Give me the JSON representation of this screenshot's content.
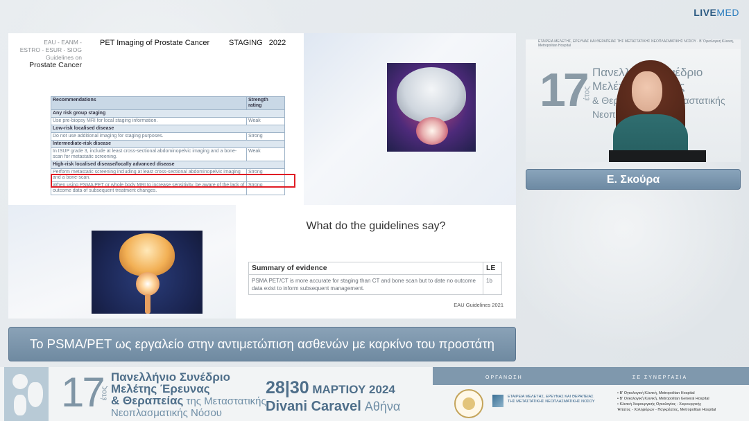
{
  "brand": {
    "live": "LIVE",
    "med": "MED"
  },
  "slide": {
    "eau_lines": [
      "EAU - EANM -",
      "ESTRO - ESUR - SIOG",
      "Guidelines on"
    ],
    "eau_pc": "Prostate Cancer",
    "title": "PET Imaging of Prostate Cancer",
    "staging": "STAGING 2022",
    "rec_table": {
      "header": [
        "Recommendations",
        "Strength rating"
      ],
      "rows": [
        {
          "type": "sub",
          "text": "Any risk group staging",
          "rating": ""
        },
        {
          "type": "row",
          "text": "Use pre-biopsy MRI for local staging information.",
          "rating": "Weak"
        },
        {
          "type": "sub",
          "text": "Low-risk localised disease",
          "rating": ""
        },
        {
          "type": "row",
          "text": "Do not use additional imaging for staging purposes.",
          "rating": "Strong"
        },
        {
          "type": "sub",
          "text": "Intermediate-risk disease",
          "rating": ""
        },
        {
          "type": "row",
          "text": "In ISUP grade 3, include at least cross-sectional abdominopelvic imaging and a bone-scan for metastatic screening.",
          "rating": "Weak"
        },
        {
          "type": "sub",
          "text": "High-risk localised disease/locally advanced disease",
          "rating": ""
        },
        {
          "type": "row",
          "text": "Perform metastatic screening including at least cross-sectional abdominopelvic imaging and a bone-scan.",
          "rating": "Strong"
        },
        {
          "type": "row",
          "text": "When using PSMA PET or whole body MRI to increase sensitivity, be aware of the lack of outcome data of subsequent treatment changes.",
          "rating": "Strong"
        }
      ]
    },
    "question": "What do the guidelines say?",
    "evidence": {
      "header": [
        "Summary of evidence",
        "LE"
      ],
      "text": "PSMA PET/CT is more accurate for staging than CT and bone scan but to date no outcome data exist to inform subsequent management.",
      "le": "1b"
    },
    "source": "EAU Guidelines 2021"
  },
  "video": {
    "banner_num": "17",
    "banner_etos": "έτος",
    "banner_lines": [
      "Πανελλήνιο Συνέδριο",
      "Μελέτης Έρευνας",
      "& Θεραπείας της Μεταστατικής",
      "Νεοπλασματικής"
    ],
    "logos_text": "ΕΤΑΙΡΕΙΑ ΜΕΛΕΤΗΣ, ΕΡΕΥΝΑΣ ΚΑΙ ΘΕΡΑΠΕΙΑΣ ΤΗΣ ΜΕΤΑΣΤΑΤΙΚΗΣ ΝΕΟΠΛΑΣΜΑΤΙΚΗΣ ΝΟΣΟΥ · Β' Ογκολογική Κλινική, Metropolitan Hospital"
  },
  "speaker": "Ε. Σκούρα",
  "subtitle": "Το PSMA/PET ως εργαλείο στην αντιμετώπιση ασθενών με καρκίνο του προστάτη",
  "footer": {
    "num": "17",
    "etos": "έτος",
    "line1": "Πανελλήνιο Συνέδριο",
    "line2": "Μελέτης Έρευνας",
    "line3a": "& Θεραπείας",
    "line3b": " της Μεταστατικής",
    "line4": "Νεοπλασματικής Νόσου",
    "day1": "28",
    "day2": "30",
    "month": " ΜΑΡΤΙΟΥ 2024",
    "venue": "Divani Caravel",
    "city": " Αθήνα",
    "org_label": "ΟΡΓΑΝΩΣΗ",
    "syn_label": "ΣΕ ΣΥΝΕΡΓΑΣΙΑ",
    "society": [
      "ΕΤΑΙΡΕΙΑ ΜΕΛΕΤΗΣ, ΕΡΕΥΝΑΣ ΚΑΙ ΘΕΡΑΠΕΙΑΣ",
      "ΤΗΣ ΜΕΤΑΣΤΑΤΙΚΗΣ ΝΕΟΠΛΑΣΜΑΤΙΚΗΣ ΝΟΣΟΥ"
    ],
    "hospitals": [
      "• Β' Ογκολογική Κλινική, Metropolitan Hospital",
      "• Β' Ογκολογική Κλινική, Metropolitan General Hospital",
      "• Κλινική Χειρουργικής Ογκολογίας - Χειρουργικής",
      "  Ήπατος - Χοληφόρων - Παγκρέατος, Metropolitan Hospital"
    ]
  }
}
